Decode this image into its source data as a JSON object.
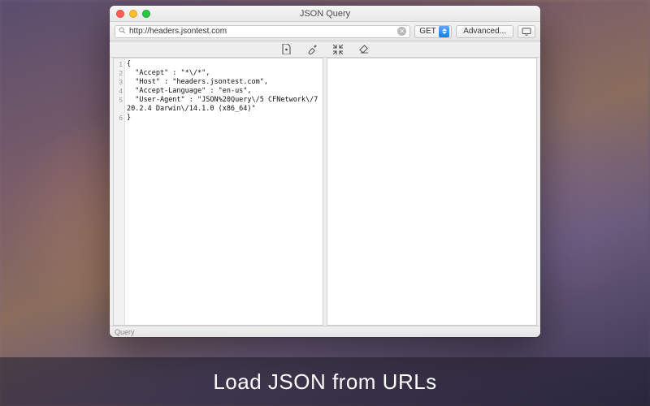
{
  "window": {
    "title": "JSON Query"
  },
  "toolbar": {
    "url_value": "http://headers.jsontest.com",
    "method_selected": "GET",
    "advanced_label": "Advanced..."
  },
  "icons": {
    "format": "format-icon",
    "prettify": "prettify-icon",
    "collapse": "collapse-icon",
    "clear": "eraser-icon"
  },
  "editor": {
    "line_numbers": [
      "1",
      "2",
      "3",
      "4",
      "5",
      "6"
    ],
    "content": "{\n  \"Accept\" : \"*\\/*\",\n  \"Host\" : \"headers.jsontest.com\",\n  \"Accept-Language\" : \"en-us\",\n  \"User-Agent\" : \"JSON%20Query\\/5 CFNetwork\\/720.2.4 Darwin\\/14.1.0 (x86_64)\"\n}"
  },
  "statusbar": {
    "text": "Query"
  },
  "caption": {
    "text": "Load JSON from URLs"
  }
}
